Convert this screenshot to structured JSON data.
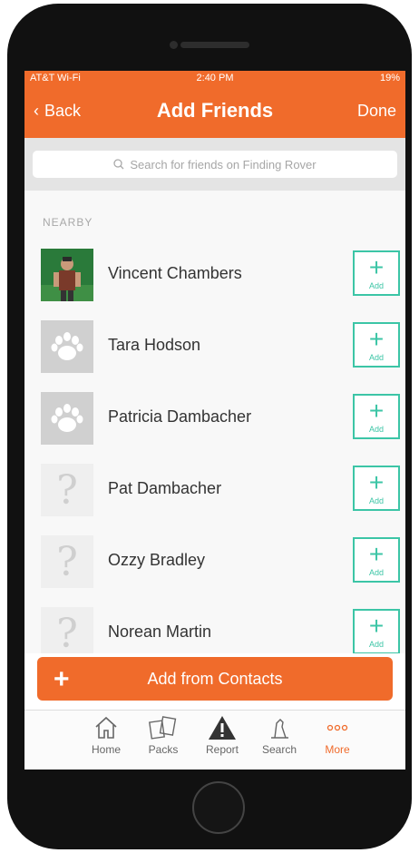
{
  "status": {
    "carrier": "AT&T Wi-Fi",
    "time": "2:40 PM",
    "battery": "19%"
  },
  "nav": {
    "back": "Back",
    "title": "Add Friends",
    "done": "Done"
  },
  "search": {
    "placeholder": "Search for friends on Finding Rover"
  },
  "section": {
    "label": "NEARBY"
  },
  "add_label": "Add",
  "friends": [
    {
      "name": "Vincent Chambers",
      "avatar": "photo"
    },
    {
      "name": "Tara Hodson",
      "avatar": "paw"
    },
    {
      "name": "Patricia Dambacher",
      "avatar": "paw"
    },
    {
      "name": "Pat Dambacher",
      "avatar": "unknown"
    },
    {
      "name": "Ozzy Bradley",
      "avatar": "unknown"
    },
    {
      "name": "Norean Martin",
      "avatar": "unknown"
    }
  ],
  "contacts_button": {
    "plus": "+",
    "label": "Add from Contacts"
  },
  "tabs": [
    {
      "label": "Home",
      "icon": "home-icon"
    },
    {
      "label": "Packs",
      "icon": "packs-icon"
    },
    {
      "label": "Report",
      "icon": "report-icon"
    },
    {
      "label": "Search",
      "icon": "search-icon"
    },
    {
      "label": "More",
      "icon": "more-icon",
      "active": true
    }
  ],
  "colors": {
    "accent": "#f06b2b",
    "add_green": "#3cc5a6"
  }
}
